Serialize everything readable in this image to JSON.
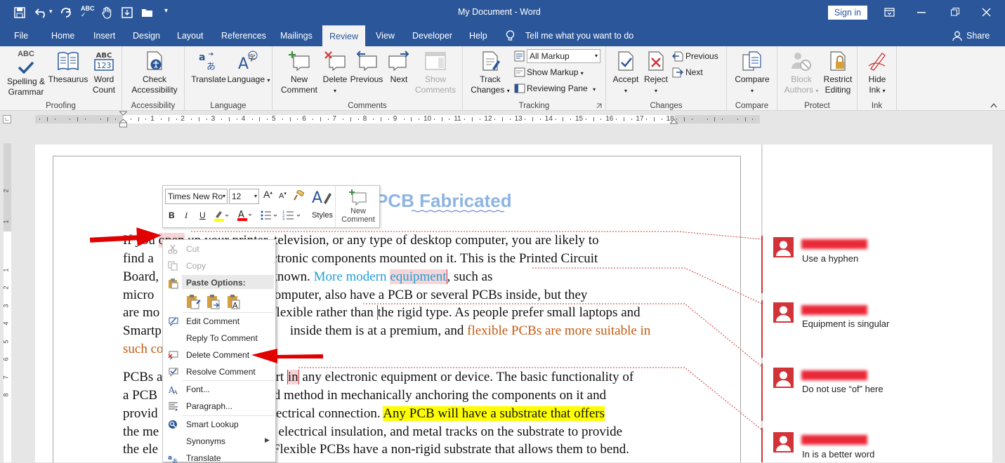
{
  "window": {
    "title": "My Document  -  Word",
    "sign_in": "Sign in"
  },
  "tabs": [
    "File",
    "Home",
    "Insert",
    "Design",
    "Layout",
    "References",
    "Mailings",
    "Review",
    "View",
    "Developer",
    "Help"
  ],
  "active_tab": "Review",
  "tell_me": "Tell me what you want to do",
  "share": "Share",
  "ribbon": {
    "proofing": {
      "label": "Proofing",
      "spelling": "Spelling &",
      "grammar": "Grammar",
      "thesaurus": "Thesaurus",
      "word": "Word",
      "count": "Count",
      "abc": "ABC",
      "n123": "123"
    },
    "accessibility": {
      "label": "Accessibility",
      "check": "Check",
      "access": "Accessibility"
    },
    "language": {
      "label": "Language",
      "translate": "Translate",
      "language": "Language"
    },
    "comments": {
      "label": "Comments",
      "new1": "New",
      "new2": "Comment",
      "delete": "Delete",
      "previous": "Previous",
      "next": "Next",
      "show1": "Show",
      "show2": "Comments"
    },
    "tracking": {
      "label": "Tracking",
      "track1": "Track",
      "track2": "Changes",
      "markup_select": "All Markup",
      "show_markup": "Show Markup",
      "reviewing_pane": "Reviewing Pane"
    },
    "changes": {
      "label": "Changes",
      "accept": "Accept",
      "reject": "Reject",
      "previous": "Previous",
      "next": "Next"
    },
    "compare": {
      "label": "Compare",
      "compare": "Compare"
    },
    "protect": {
      "label": "Protect",
      "block1": "Block",
      "block2": "Authors",
      "restrict1": "Restrict",
      "restrict2": "Editing"
    },
    "ink": {
      "label": "Ink",
      "hide1": "Hide",
      "hide2": "Ink"
    }
  },
  "ruler_numbers": [
    "1",
    "2",
    "3",
    "4",
    "5",
    "6",
    "7",
    "8",
    "9",
    "10",
    "11",
    "12",
    "13",
    "14",
    "15",
    "16",
    "17",
    "18"
  ],
  "vruler_numbers": [
    "2",
    "1",
    "1",
    "2",
    "3",
    "4",
    "5",
    "6",
    "7",
    "8"
  ],
  "doc": {
    "heading": "PCB Fabricated",
    "lines": [
      {
        "a": "If you ",
        "b": "open",
        "c": " up your printer, television, or any type of desktop computer, you are likely to"
      },
      {
        "a": "find a ",
        "c": "board with electronic components mounted on it. This is the Printed Circuit"
      },
      {
        "a": "Board, ",
        "c": "is commonly unknown. ",
        "blue": "More modern ",
        "eq": "equipment",
        ",": ", such as"
      },
      {
        "a": "micro ",
        "c": "laptop computer, also have a PCB or several PCBs inside, but they"
      },
      {
        "a": "are mo",
        "c": "flexible rather than ",
        "d": "the rigid type. As people prefer small laptops and"
      },
      {
        "a": "Smartp",
        "c": "inside them is at a premium, and ",
        "orange": "flexible PCBs are more suitable in"
      },
      {
        "orange": "such co"
      },
      {
        "a": "PCBs a",
        "c": "rt ",
        "in": "in",
        " d": " any electronic equipment or device. The basic functionality of"
      },
      {
        "a": "a PCB ",
        "c": "and method in mechanically anchoring the components on it and"
      },
      {
        "a": "provid",
        "c": "er electrical connection. ",
        "yellow": "Any PCB will have a substrate that offers"
      },
      {
        "a": "the me",
        "c": "d electrical insulation, and metal tracks on the substrate to provide"
      },
      {
        "a": "the ele",
        "c": " Flexible PCBs have a non-rigid substrate that allows them to bend."
      }
    ]
  },
  "comments": [
    {
      "text": "Use a hyphen"
    },
    {
      "text": "Equipment is singular"
    },
    {
      "text": "Do not use “of” here"
    },
    {
      "text": "In is a better word"
    }
  ],
  "mini_toolbar": {
    "font": "Times New Ro",
    "size": "12",
    "bold": "B",
    "italic": "I",
    "underline": "U",
    "styles": "Styles",
    "new1": "New",
    "new2": "Comment"
  },
  "context_menu": {
    "cut": "Cut",
    "copy": "Copy",
    "paste_options": "Paste Options:",
    "edit": "Edit Comment",
    "reply": "Reply To Comment",
    "delete": "Delete Comment",
    "resolve": "Resolve Comment",
    "font": "Font...",
    "paragraph": "Paragraph...",
    "smart": "Smart Lookup",
    "synonyms": "Synonyms",
    "translate": "Translate"
  },
  "colors": {
    "word_blue": "#2b579a",
    "comment_red": "#d13438",
    "arrow_red": "#e00000",
    "link_blue": "#21a0d8",
    "orange": "#c55a11",
    "highlight": "#ffff00"
  }
}
